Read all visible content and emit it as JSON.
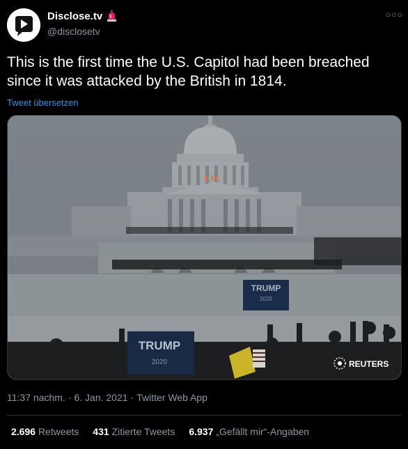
{
  "author": {
    "name": "Disclose.tv",
    "handle": "@disclosetv",
    "verified_badge_icon": "police-siren-icon"
  },
  "tweet": {
    "text_line1": "This is the first time the U.S. Capitol had been breached",
    "text_line2": "since it was attacked by the British in 1814.",
    "translate_label": "Tweet übersetzen"
  },
  "media": {
    "sign_big": "TRUMP",
    "sign_big_sub": "2020",
    "sign_banner": "TRUMP",
    "sign_banner_sub": "2020",
    "watermark": "REUTERS"
  },
  "meta": {
    "time": "11:37 nachm.",
    "date": "6. Jan. 2021",
    "source": "Twitter Web App",
    "separator": "·"
  },
  "stats": {
    "retweets_num": "2.696",
    "retweets_label": "Retweets",
    "quotes_num": "431",
    "quotes_label": "Zitierte Tweets",
    "likes_num": "6.937",
    "likes_label": "„Gefällt mir“-Angaben"
  },
  "colors": {
    "accent": "#1d9bf0",
    "muted": "#8b98a5",
    "background": "#000000"
  }
}
